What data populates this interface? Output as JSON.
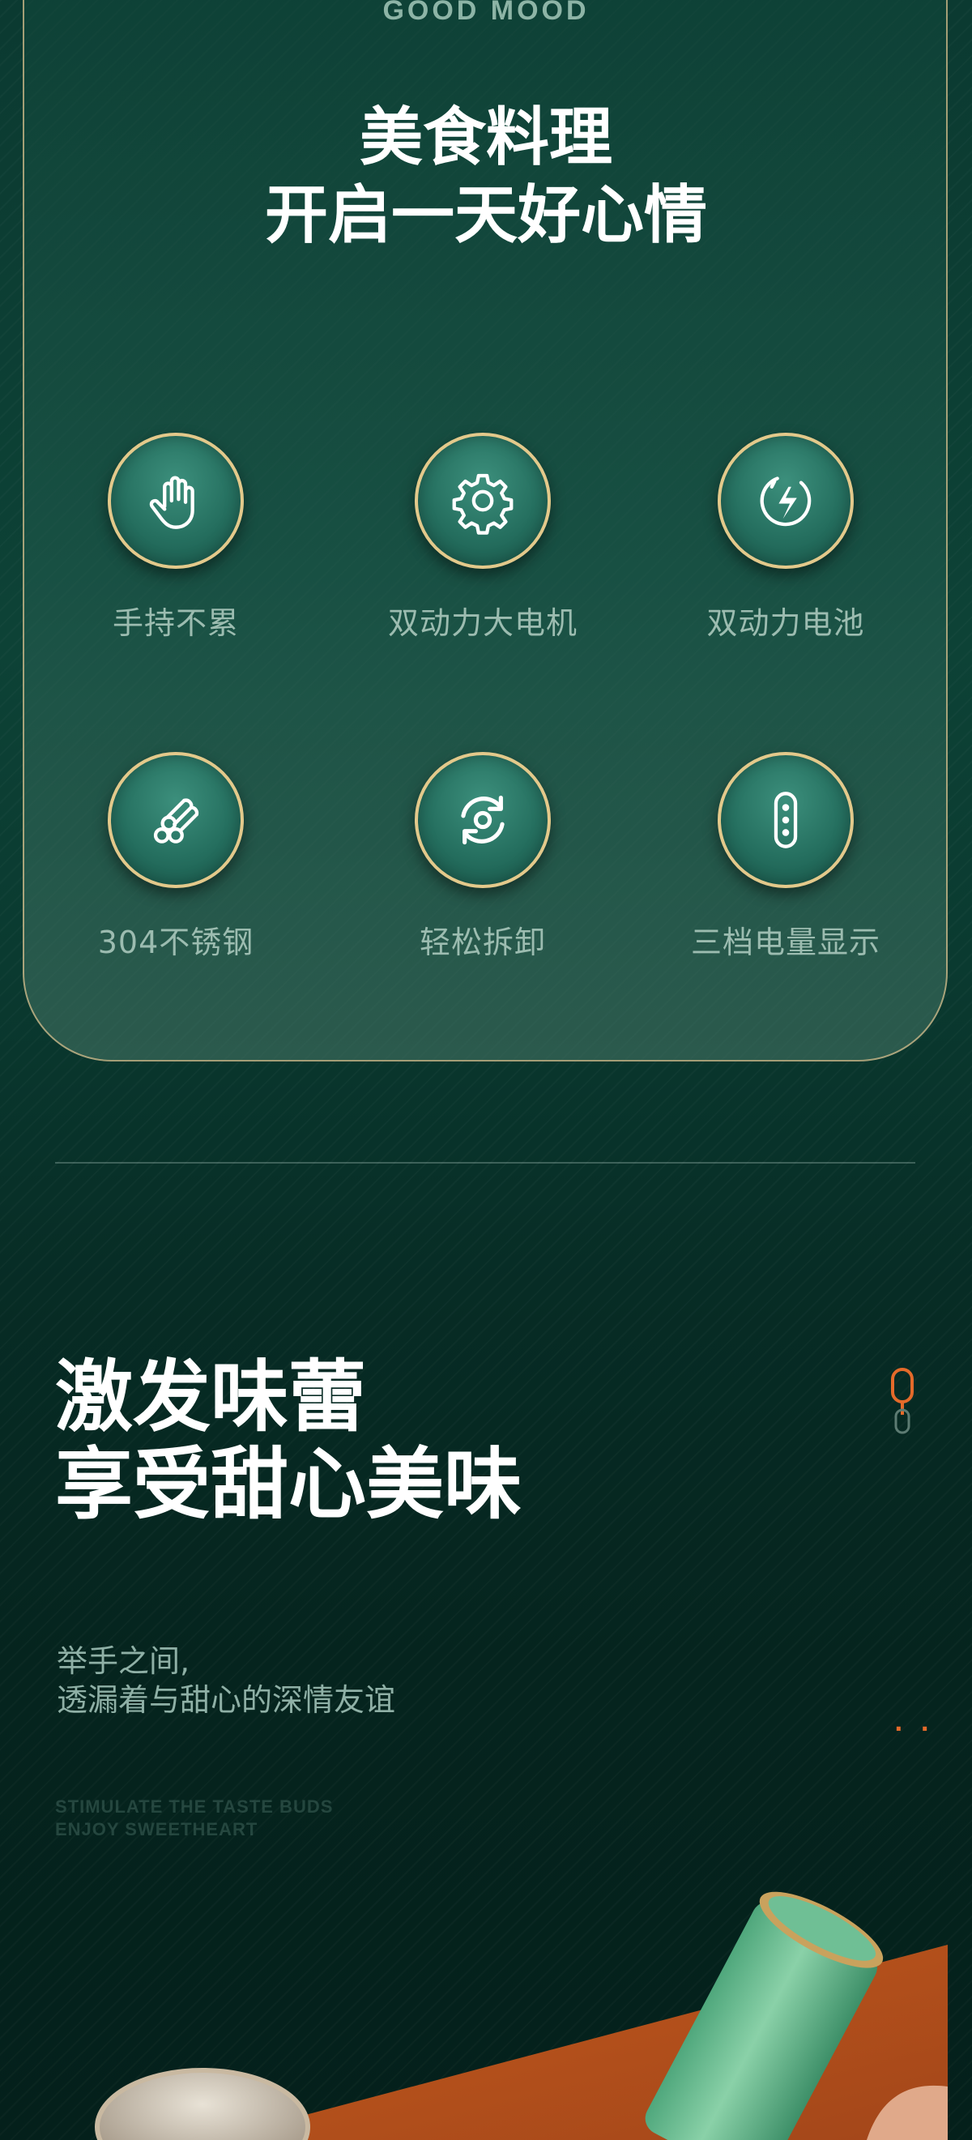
{
  "header": {
    "english_tag": "GOOD MOOD",
    "headline_line1": "美食料理",
    "headline_line2": "开启一天好心情"
  },
  "features": [
    {
      "label": "手持不累",
      "icon": "hand-icon"
    },
    {
      "label": "双动力大电机",
      "icon": "gear-icon"
    },
    {
      "label": "双动力电池",
      "icon": "lightning-timer-icon"
    },
    {
      "label": "304不锈钢",
      "icon": "steel-rods-icon"
    },
    {
      "label": "轻松拆卸",
      "icon": "rotate-icon"
    },
    {
      "label": "三档电量显示",
      "icon": "battery-level-icon"
    }
  ],
  "section2": {
    "title_line1": "激发味蕾",
    "title_line2": "享受甜心美味",
    "subtitle_line1": "举手之间,",
    "subtitle_line2": "透漏着与甜心的深情友谊",
    "english_line1": "STIMULATE THE TASTE BUDS",
    "english_line2": "ENJOY SWEETHEART",
    "dots_text": ". ."
  },
  "colors": {
    "background": "#0b3a31",
    "gold_ring": "#e3c98b",
    "accent_orange": "#e46a2a",
    "label_text": "#9cbcb0"
  }
}
